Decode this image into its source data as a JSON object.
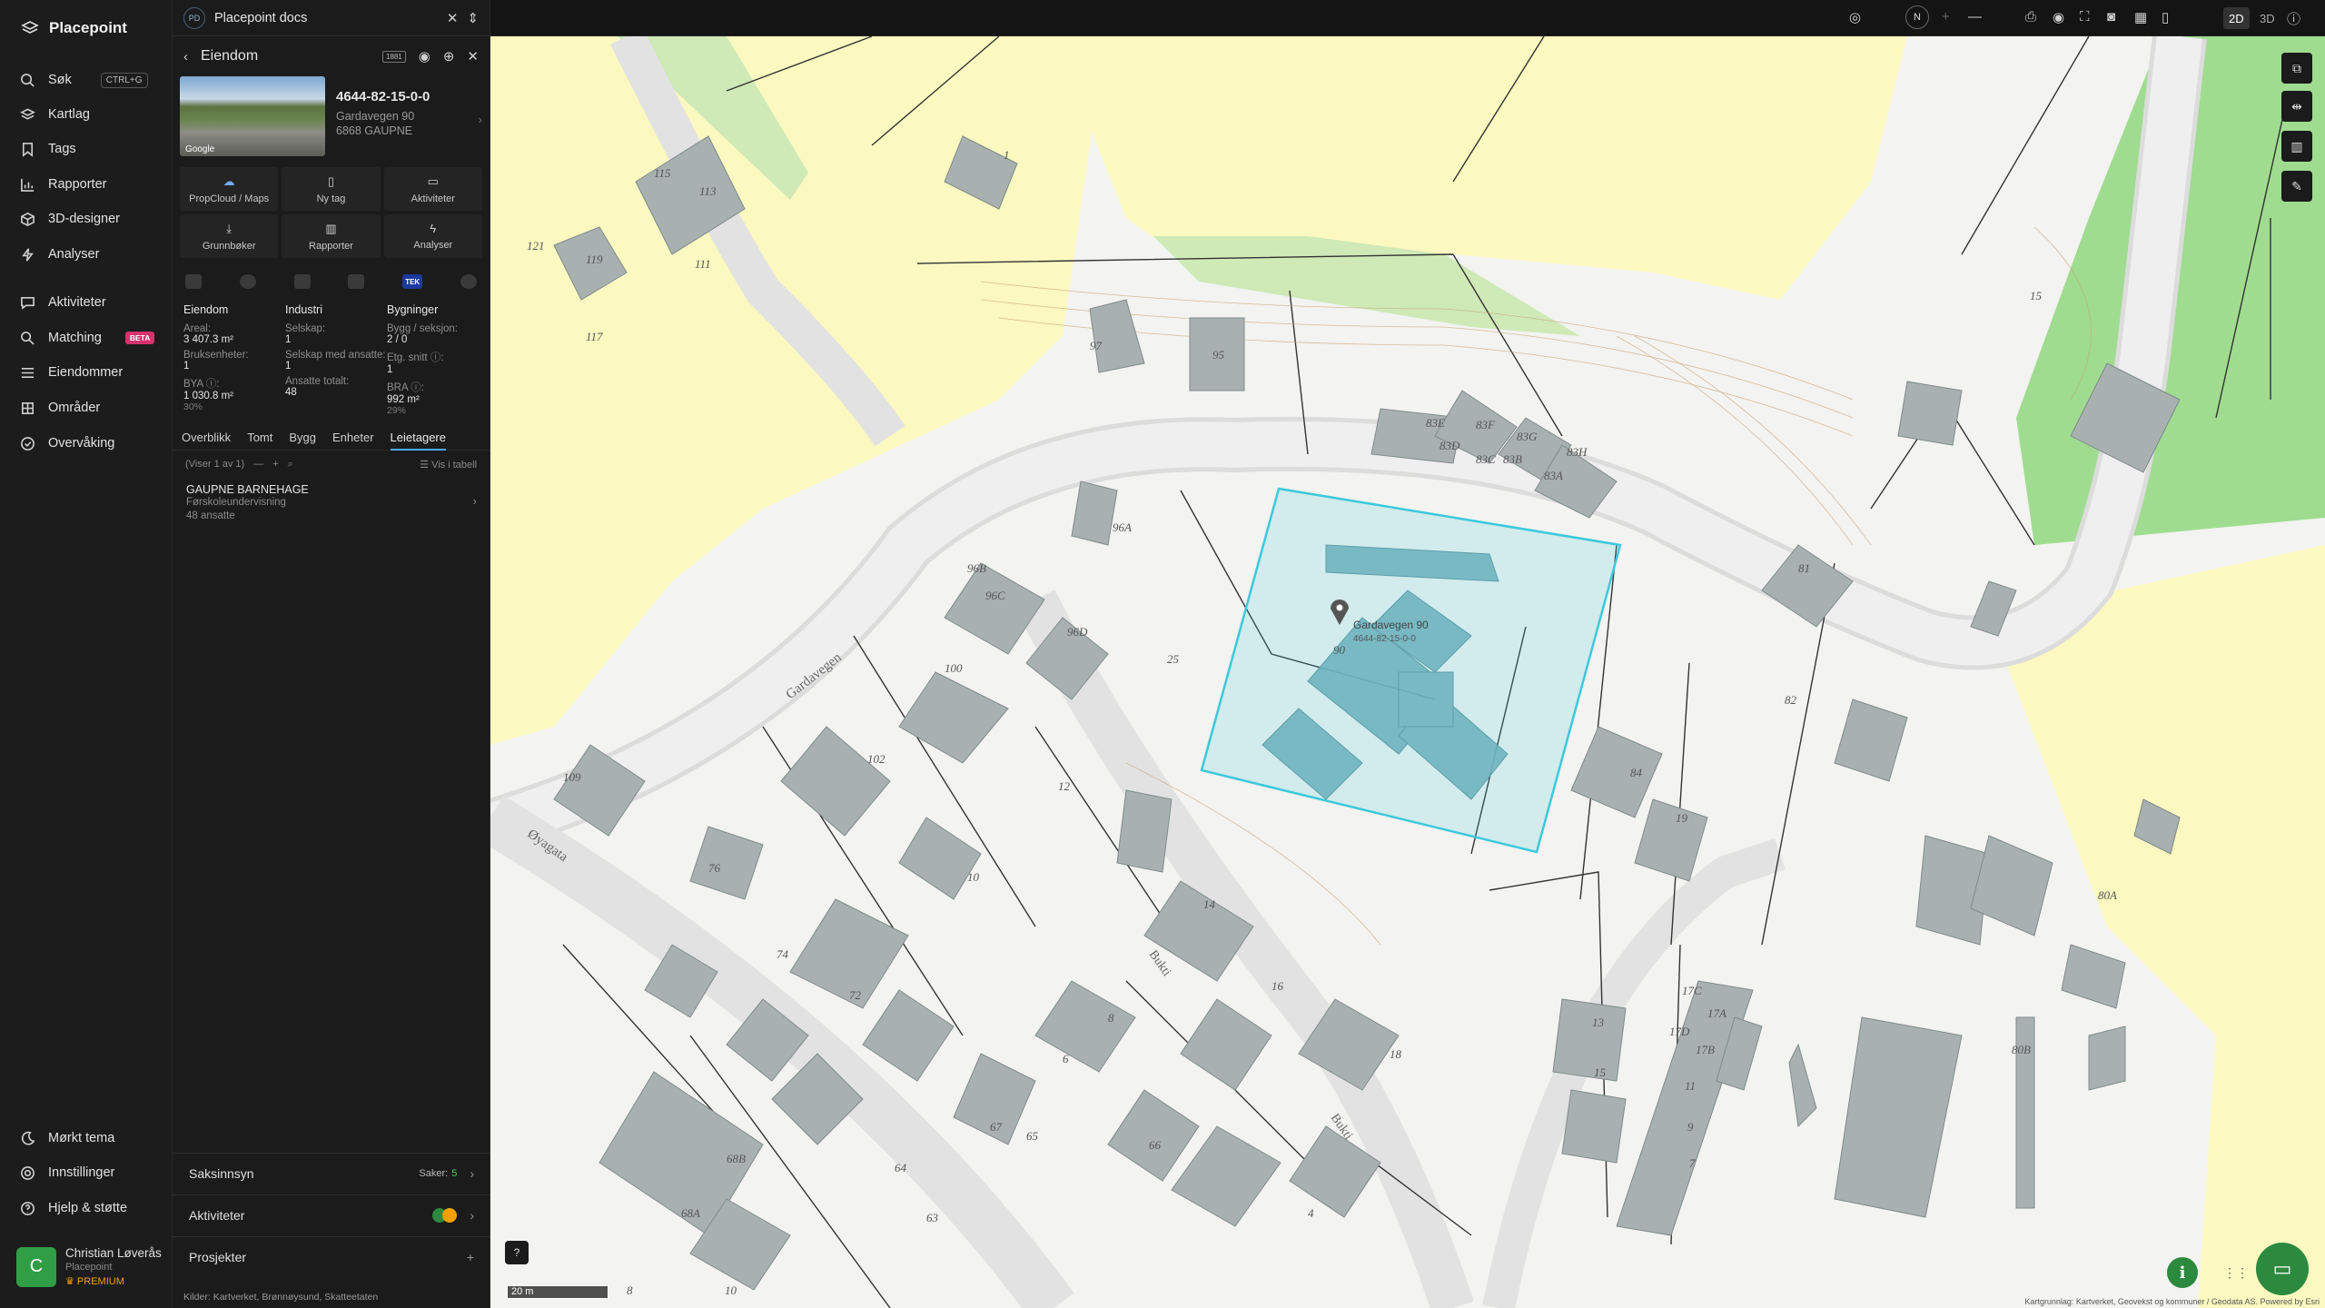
{
  "app": {
    "name": "Placepoint"
  },
  "nav": {
    "items": [
      {
        "label": "Søk",
        "shortcut": "CTRL+G",
        "icon": "search-icon"
      },
      {
        "label": "Kartlag",
        "icon": "layers-icon"
      },
      {
        "label": "Tags",
        "icon": "bookmark-icon"
      },
      {
        "label": "Rapporter",
        "icon": "chart-icon"
      },
      {
        "label": "3D-designer",
        "icon": "cube-icon"
      },
      {
        "label": "Analyser",
        "icon": "bolt-icon"
      },
      {
        "label": "Aktiviteter",
        "icon": "message-icon"
      },
      {
        "label": "Matching",
        "badge": "BETA",
        "icon": "match-icon"
      },
      {
        "label": "Eiendommer",
        "icon": "list-icon"
      },
      {
        "label": "Områder",
        "icon": "area-icon"
      },
      {
        "label": "Overvåking",
        "icon": "monitor-icon"
      }
    ],
    "bottom": [
      {
        "label": "Mørkt tema",
        "icon": "moon-icon"
      },
      {
        "label": "Innstillinger",
        "icon": "gear-icon"
      },
      {
        "label": "Hjelp & støtte",
        "icon": "help-icon"
      }
    ],
    "user": {
      "initial": "C",
      "name": "Christian Løverås",
      "org": "Placepoint",
      "plan": "PREMIUM"
    }
  },
  "panel": {
    "top": {
      "badge": "PD",
      "title": "Placepoint docs"
    },
    "header": {
      "title": "Eiendom",
      "badge": "1881"
    },
    "property": {
      "id": "4644-82-15-0-0",
      "address": "Gardavegen 90",
      "postal": "6868 GAUPNE",
      "photo_label": "Google"
    },
    "actions": [
      {
        "label": "PropCloud / Maps",
        "icon": "cloud-icon"
      },
      {
        "label": "Ny tag",
        "icon": "bookmark-icon"
      },
      {
        "label": "Aktiviteter",
        "icon": "message-icon"
      },
      {
        "label": "Grunnbøker",
        "icon": "download-icon"
      },
      {
        "label": "Rapporter",
        "icon": "chart-icon"
      },
      {
        "label": "Analyser",
        "icon": "bolt-icon"
      }
    ],
    "icon_row_tek": "TEK",
    "stats": {
      "eiendom": {
        "heading": "Eiendom",
        "areal_label": "Areal:",
        "areal": "3 407.3 m²",
        "bruks_label": "Bruksenheter:",
        "bruks": "1",
        "bya_label": "BYA ⓘ:",
        "bya": "1 030.8 m²",
        "bya_pct": "30%"
      },
      "industri": {
        "heading": "Industri",
        "selskap_label": "Selskap:",
        "selskap": "1",
        "ansatte_label": "Selskap med ansatte:",
        "ansatte": "1",
        "totalt_label": "Ansatte totalt:",
        "totalt": "48"
      },
      "bygninger": {
        "heading": "Bygninger",
        "seksjon_label": "Bygg / seksjon:",
        "seksjon": "2 / 0",
        "etg_label": "Etg. snitt ⓘ:",
        "etg": "1",
        "bra_label": "BRA ⓘ:",
        "bra": "992 m²",
        "bra_pct": "29%"
      }
    },
    "tabs": [
      "Overblikk",
      "Tomt",
      "Bygg",
      "Enheter",
      "Leietagere"
    ],
    "active_tab": "Leietagere",
    "list": {
      "count": "(Viser 1 av 1)",
      "table_link": "Vis i tabell"
    },
    "tenants": [
      {
        "name": "GAUPNE BARNEHAGE",
        "type": "Førskoleundervisning",
        "employees": "48 ansatte"
      }
    ],
    "sections": {
      "saksinnsyn": "Saksinnsyn",
      "saker_label": "Saker:",
      "saker_count": "5",
      "aktiviteter": "Aktiviteter",
      "prosjekter": "Prosjekter"
    },
    "sources": {
      "label": "Kilder:",
      "items": [
        "Kartverket,",
        "Brønnøysund,",
        "Skatteetaten"
      ]
    }
  },
  "topbar": {
    "compass": "N",
    "mode_2d": "2D",
    "mode_3d": "3D"
  },
  "map": {
    "scale": "20 m",
    "marker_label": "Gardavegen 90",
    "marker_sub": "4644-82-15-0-0",
    "street_labels": [
      "Gardavegen",
      "Øyagata",
      "Bukti",
      "Bukti"
    ],
    "house_numbers": [
      "1",
      "115",
      "113",
      "111",
      "121",
      "119",
      "117",
      "97",
      "95",
      "83E",
      "83F",
      "83G",
      "83H",
      "83D",
      "83C",
      "83B",
      "83A",
      "81",
      "96A",
      "96B",
      "96C",
      "96D",
      "100",
      "102",
      "25",
      "90",
      "82",
      "84",
      "19",
      "15",
      "109",
      "12",
      "10",
      "76",
      "74",
      "72",
      "14",
      "16",
      "8",
      "6",
      "67",
      "65",
      "66",
      "63",
      "64",
      "68B",
      "68A",
      "18",
      "15",
      "13",
      "17C",
      "17A",
      "17D",
      "17B",
      "11",
      "9",
      "7",
      "80A",
      "80B",
      "4",
      "10",
      "8"
    ],
    "attribution": "Kartgrunnlag: Kartverket, Geovekst og kommuner / Geodata AS. Powered by Esri",
    "colors": {
      "background": "#f3f3f1",
      "yellow": "#fbf8c0",
      "green": "#9fdc90",
      "building": "#a8b1b0",
      "selection": "#3bc9db"
    }
  }
}
